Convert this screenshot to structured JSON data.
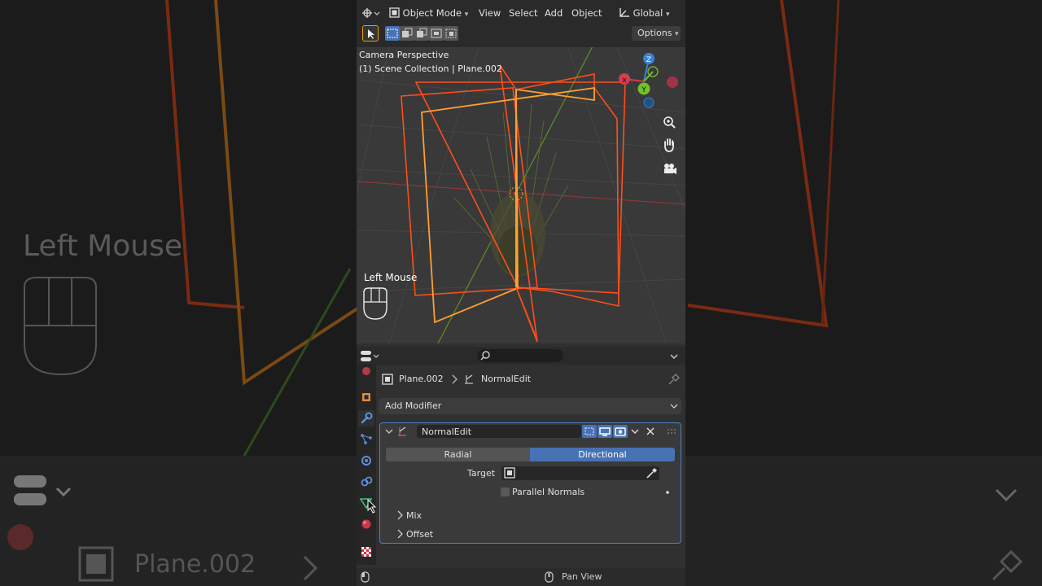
{
  "background": {
    "left_mouse_label": "Left Mouse",
    "object_name": "Plane.002"
  },
  "header": {
    "mode_label": "Object Mode",
    "menu": [
      "View",
      "Select",
      "Add",
      "Object"
    ],
    "transform_orientation": "Global",
    "options_label": "Options"
  },
  "viewport": {
    "camera_label": "Camera Perspective",
    "collection_label": "(1) Scene Collection | Plane.002",
    "input_overlay_label": "Left Mouse",
    "gizmo": {
      "z": "Z",
      "y": "Y",
      "x_color": "#d63b4f",
      "y_color": "#72c02a",
      "z_color": "#3b80d6"
    }
  },
  "properties": {
    "breadcrumb_object": "Plane.002",
    "breadcrumb_modifier": "NormalEdit",
    "add_modifier_label": "Add Modifier",
    "modifier": {
      "name": "NormalEdit",
      "mode_options": [
        "Radial",
        "Directional"
      ],
      "selected_mode": "Directional",
      "target_label": "Target",
      "target_value": "",
      "parallel_normals_label": "Parallel Normals",
      "parallel_normals_checked": false,
      "sections": [
        "Mix",
        "Offset"
      ]
    }
  },
  "status_bar": {
    "hint": "Pan View"
  },
  "colors": {
    "accent": "#4772b3",
    "selected_outline": "#ff4e1a",
    "active_outline": "#ffa032"
  }
}
